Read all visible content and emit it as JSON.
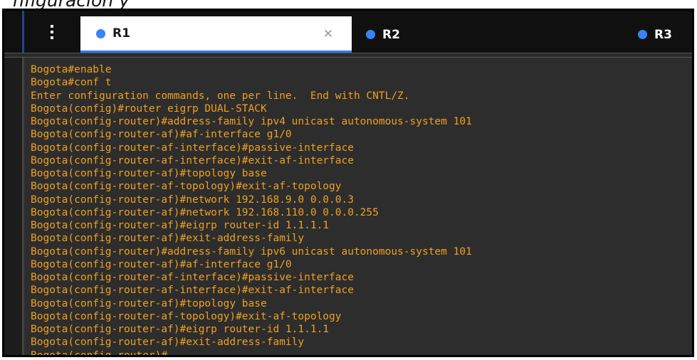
{
  "caption": "nfiguración y",
  "menu": {
    "icon": "kebab-menu-icon"
  },
  "tabs": [
    {
      "label": "R1",
      "active": true,
      "status_color": "#3a82f7",
      "close_icon": "close-icon"
    },
    {
      "label": "R2",
      "active": false,
      "status_color": "#3a82f7"
    },
    {
      "label": "R3",
      "active": false,
      "status_color": "#3a82f7"
    }
  ],
  "terminal": {
    "text_color": "#f0a020",
    "lines": [
      "Bogota#enable",
      "Bogota#conf t",
      "Enter configuration commands, one per line.  End with CNTL/Z.",
      "Bogota(config)#router eigrp DUAL-STACK",
      "Bogota(config-router)#address-family ipv4 unicast autonomous-system 101",
      "Bogota(config-router-af)#af-interface g1/0",
      "Bogota(config-router-af-interface)#passive-interface",
      "Bogota(config-router-af-interface)#exit-af-interface",
      "Bogota(config-router-af)#topology base",
      "Bogota(config-router-af-topology)#exit-af-topology",
      "Bogota(config-router-af)#network 192.168.9.0 0.0.0.3",
      "Bogota(config-router-af)#network 192.168.110.0 0.0.0.255",
      "Bogota(config-router-af)#eigrp router-id 1.1.1.1",
      "Bogota(config-router-af)#exit-address-family",
      "Bogota(config-router)#address-family ipv6 unicast autonomous-system 101",
      "Bogota(config-router-af)#af-interface g1/0",
      "Bogota(config-router-af-interface)#passive-interface",
      "Bogota(config-router-af-interface)#exit-af-interface",
      "Bogota(config-router-af)#topology base",
      "Bogota(config-router-af-topology)#exit-af-topology",
      "Bogota(config-router-af)#eigrp router-id 1.1.1.1",
      "Bogota(config-router-af)#exit-address-family",
      "Bogota(config-router)#"
    ]
  }
}
